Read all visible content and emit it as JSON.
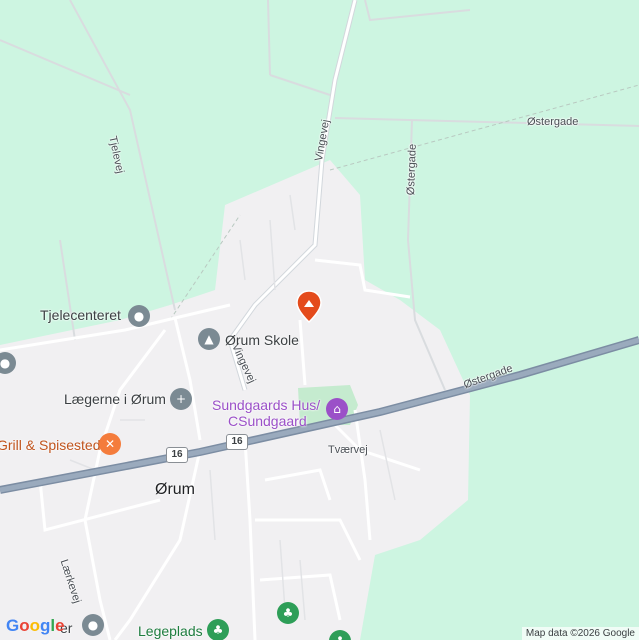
{
  "map": {
    "attribution": "Map data ©2026 Google",
    "logo_letters": [
      {
        "ch": "G",
        "color": "#4285f4"
      },
      {
        "ch": "o",
        "color": "#ea4335"
      },
      {
        "ch": "o",
        "color": "#fbbc05"
      },
      {
        "ch": "g",
        "color": "#4285f4"
      },
      {
        "ch": "l",
        "color": "#34a853"
      },
      {
        "ch": "e",
        "color": "#ea4335"
      }
    ],
    "colors": {
      "land": "#cdf5e1",
      "urban": "#f1f0f2",
      "highway": "#8a9bb1",
      "road": "#ffffff",
      "poi_gray": "#7b8a93",
      "poi_purple": "#9b50c8",
      "poi_orange": "#f47c3c",
      "poi_green": "#2e9e58",
      "marker": "#e44b1c"
    },
    "road_labels": {
      "tjelevej": "Tjelevej",
      "vingevej_north": "Vingevej",
      "vingevej_south": "Vingevej",
      "ostergade_ne": "Østergade",
      "ostergade_vertical": "Østergade",
      "ostergade_main": "Østergade",
      "tvaervej": "Tværvej",
      "laerkevej": "Lærkevej"
    },
    "shields": {
      "left": "16",
      "right": "16"
    },
    "town_label": "Ørum",
    "pois": {
      "tjelecenteret": "Tjelecenteret",
      "orum_skole": "Ørum Skole",
      "laegerne": "Lægerne i Ørum",
      "sundgaards_line1": "Sundgaards Hus/",
      "sundgaards_line2": "CSundgaard",
      "grill": "Grill & Spisested",
      "legeplads": "Legeplads",
      "partial_bottom": "er"
    }
  }
}
